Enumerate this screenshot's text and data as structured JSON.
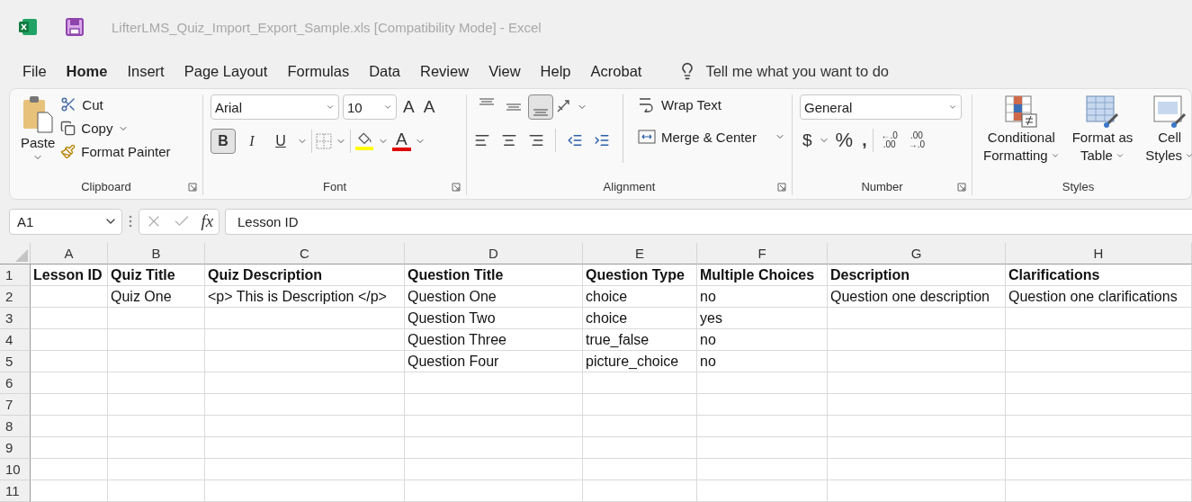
{
  "window": {
    "title": "LifterLMS_Quiz_Import_Export_Sample.xls  [Compatibility Mode]  -  Excel"
  },
  "menu_tabs": [
    {
      "label": "File",
      "selected": false
    },
    {
      "label": "Home",
      "selected": true
    },
    {
      "label": "Insert",
      "selected": false
    },
    {
      "label": "Page Layout",
      "selected": false
    },
    {
      "label": "Formulas",
      "selected": false
    },
    {
      "label": "Data",
      "selected": false
    },
    {
      "label": "Review",
      "selected": false
    },
    {
      "label": "View",
      "selected": false
    },
    {
      "label": "Help",
      "selected": false
    },
    {
      "label": "Acrobat",
      "selected": false
    }
  ],
  "tell_me": {
    "placeholder": "Tell me what you want to do"
  },
  "ribbon": {
    "clipboard": {
      "label": "Clipboard",
      "paste": "Paste",
      "cut": "Cut",
      "copy": "Copy",
      "format_painter": "Format Painter"
    },
    "font": {
      "label": "Font",
      "font_name": "Arial",
      "font_size": "10",
      "grow": "A",
      "shrink": "A",
      "bold": {
        "label": "B",
        "selected": true
      },
      "italic": {
        "label": "I",
        "selected": false
      },
      "underline": {
        "label": "U",
        "selected": false
      },
      "font_color": "A"
    },
    "alignment": {
      "label": "Alignment",
      "vertical": [
        {
          "kind": "top",
          "selected": false
        },
        {
          "kind": "middle",
          "selected": false
        },
        {
          "kind": "bottom",
          "selected": true
        }
      ],
      "wrap_text": "Wrap Text",
      "merge_center": "Merge & Center"
    },
    "number": {
      "label": "Number",
      "format": "General",
      "currency": "$",
      "percent": "%",
      "comma": ",",
      "increase_decimal": [
        "←.0",
        ".00"
      ],
      "decrease_decimal": [
        ".00",
        "→.0"
      ]
    },
    "styles": {
      "label": "Styles",
      "buttons": [
        {
          "kind": "conditional",
          "lines": [
            "Conditional",
            "Formatting"
          ]
        },
        {
          "kind": "table",
          "lines": [
            "Format as",
            "Table"
          ]
        },
        {
          "kind": "cell",
          "lines": [
            "Cell",
            "Styles"
          ]
        }
      ]
    }
  },
  "formula_bar": {
    "name_box": "A1",
    "fx": "fx",
    "value": "Lesson ID"
  },
  "sheet": {
    "columns": [
      "A",
      "B",
      "C",
      "D",
      "E",
      "F",
      "G",
      "H"
    ],
    "rows": [
      {
        "number": "1",
        "cells": [
          "Lesson ID",
          "Quiz Title",
          "Quiz Description",
          "Question Title",
          "Question Type",
          "Multiple Choices",
          "Description",
          "Clarifications"
        ]
      },
      {
        "number": "2",
        "cells": [
          "",
          "Quiz One",
          "<p> This is Description </p>",
          "Question One",
          "choice",
          "no",
          "Question one description",
          "Question one clarifications"
        ]
      },
      {
        "number": "3",
        "cells": [
          "",
          "",
          "",
          "Question Two",
          "choice",
          "yes",
          "",
          ""
        ]
      },
      {
        "number": "4",
        "cells": [
          "",
          "",
          "",
          "Question Three",
          "true_false",
          "no",
          "",
          ""
        ]
      },
      {
        "number": "5",
        "cells": [
          "",
          "",
          "",
          "Question Four",
          "picture_choice",
          "no",
          "",
          ""
        ]
      },
      {
        "number": "6",
        "cells": [
          "",
          "",
          "",
          "",
          "",
          "",
          "",
          ""
        ]
      },
      {
        "number": "7",
        "cells": [
          "",
          "",
          "",
          "",
          "",
          "",
          "",
          ""
        ]
      },
      {
        "number": "8",
        "cells": [
          "",
          "",
          "",
          "",
          "",
          "",
          "",
          ""
        ]
      },
      {
        "number": "9",
        "cells": [
          "",
          "",
          "",
          "",
          "",
          "",
          "",
          ""
        ]
      },
      {
        "number": "10",
        "cells": [
          "",
          "",
          "",
          "",
          "",
          "",
          "",
          ""
        ]
      },
      {
        "number": "11",
        "cells": [
          "",
          "",
          "",
          "",
          "",
          "",
          "",
          ""
        ]
      }
    ]
  }
}
